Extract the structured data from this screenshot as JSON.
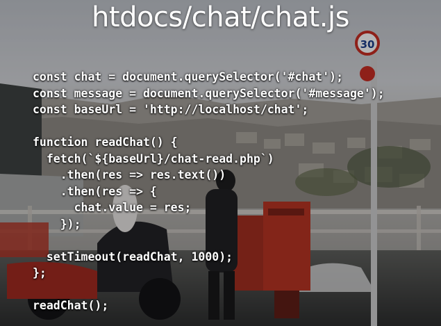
{
  "slide": {
    "title": "htdocs/chat/chat.js",
    "code_lines": [
      "const chat = document.querySelector('#chat');",
      "const message = document.querySelector('#message');",
      "const baseUrl = 'http://localhost/chat';",
      "",
      "function readChat() {",
      "  fetch(`${baseUrl}/chat-read.php`)",
      "    .then(res => res.text())",
      "    .then(res => {",
      "      chat.value = res;",
      "    });",
      "",
      "  setTimeout(readChat, 1000);",
      "};",
      "",
      "readChat();"
    ]
  },
  "sign_text": "30",
  "colors": {
    "sky": "#c9ccd1",
    "mailbox": "#b8311f",
    "text": "#ffffff"
  }
}
